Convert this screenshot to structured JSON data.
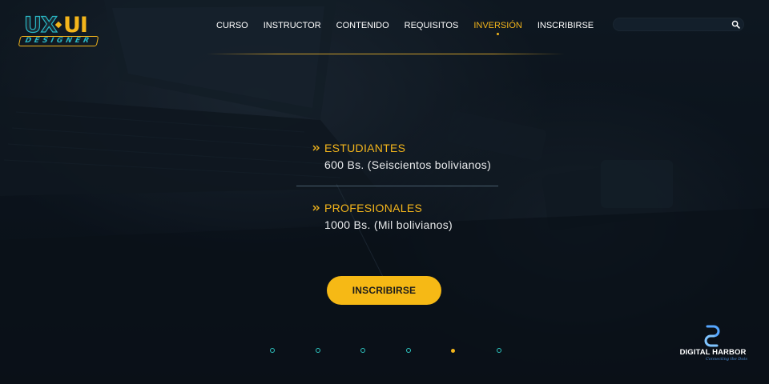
{
  "brand": {
    "logo_main": "UX",
    "logo_accent": "UI",
    "logo_sub": "DESIGNER"
  },
  "nav": {
    "items": [
      {
        "label": "CURSO",
        "active": false
      },
      {
        "label": "INSTRUCTOR",
        "active": false
      },
      {
        "label": "CONTENIDO",
        "active": false
      },
      {
        "label": "REQUISITOS",
        "active": false
      },
      {
        "label": "INVERSIÓN",
        "active": true
      },
      {
        "label": "INSCRIBIRSE",
        "active": false
      }
    ]
  },
  "search": {
    "placeholder": "",
    "icon": "search-icon"
  },
  "pricing": {
    "students": {
      "title": "ESTUDIANTES",
      "value": "600 Bs. (Seiscientos bolivianos)"
    },
    "professionals": {
      "title": "PROFESIONALES",
      "value": "1000 Bs. (Mil bolivianos)"
    }
  },
  "cta": {
    "label": "INSCRIBIRSE"
  },
  "pagination": {
    "count": 6,
    "active_index": 4
  },
  "partner": {
    "name": "DIGITAL HARBOR",
    "tagline": "Connecting the Dots"
  },
  "colors": {
    "accent": "#f3b51b",
    "teal": "#2ec5c0",
    "background": "#0f1a24"
  }
}
